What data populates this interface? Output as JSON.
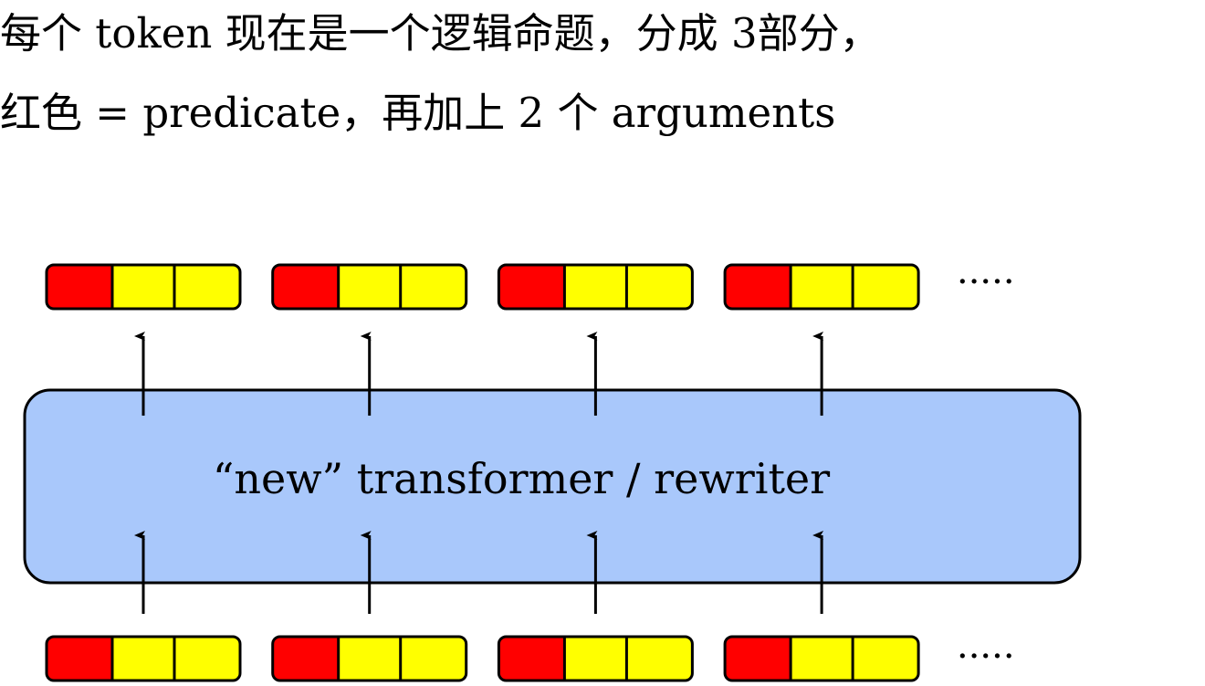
{
  "caption": {
    "line1": "每个 token 现在是一个逻辑命题，分成 3部分，",
    "line2": "红色 = predicate，再加上 2 个 arguments"
  },
  "diagram": {
    "transformer_label": "“new” transformer / rewriter",
    "ellipsis": "·····",
    "token_count_per_row": 4,
    "token_segments": [
      {
        "role": "predicate",
        "color": "#ff0000"
      },
      {
        "role": "argument",
        "color": "#ffff00"
      },
      {
        "role": "argument",
        "color": "#ffff00"
      }
    ],
    "transformer_fill": "#a9c8fb"
  }
}
